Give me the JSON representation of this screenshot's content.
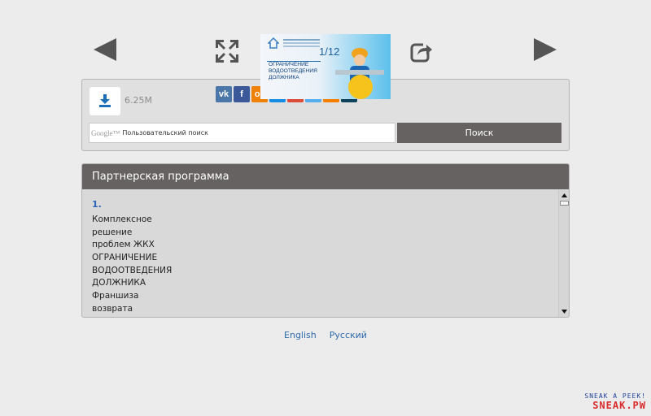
{
  "thumbnail": {
    "counter": "1/12",
    "lines": [
      "ОГРАНИЧЕНИЕ",
      "ВОДООТВЕДЕНИЯ",
      "ДОЛЖНИКА"
    ]
  },
  "download": {
    "size": "6.25M"
  },
  "social": [
    {
      "icon": "vk-icon",
      "glyph": "vk",
      "color": "#4a76a8"
    },
    {
      "icon": "facebook-icon",
      "glyph": "f",
      "color": "#3b5998"
    },
    {
      "icon": "odnoklassniki-icon",
      "glyph": "ок",
      "color": "#ee8208"
    },
    {
      "icon": "mailru-icon",
      "glyph": "@",
      "color": "#168de2"
    },
    {
      "icon": "googleplus-icon",
      "glyph": "g+",
      "color": "#dd4b39"
    },
    {
      "icon": "twitter-icon",
      "glyph": "t",
      "color": "#55acee"
    },
    {
      "icon": "blogger-icon",
      "glyph": "B",
      "color": "#f57d00"
    },
    {
      "icon": "livejournal-icon",
      "glyph": "lj",
      "color": "#0d425a"
    }
  ],
  "search": {
    "google_label": "Google™",
    "placeholder": "Пользовательский поиск",
    "button": "Поиск"
  },
  "affiliate": {
    "title": "Партнерская программа",
    "item_number": "1.",
    "lines": [
      "Комплексное",
      "решение",
      "проблем ЖКХ",
      "ОГРАНИЧЕНИЕ",
      "ВОДООТВЕДЕНИЯ",
      "ДОЛЖНИКА",
      "Франшиза",
      "возврата"
    ]
  },
  "languages": [
    "English",
    "Русский"
  ],
  "watermark": {
    "top": "SNEAK A PEEK!",
    "bottom": "SNEAK.PW"
  }
}
